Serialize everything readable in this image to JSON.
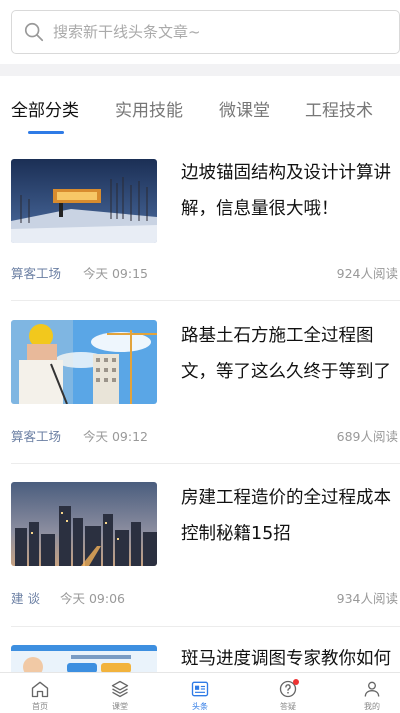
{
  "search": {
    "placeholder": "搜索新干线头条文章~"
  },
  "tabs": [
    {
      "label": "全部分类",
      "active": true
    },
    {
      "label": "实用技能",
      "active": false
    },
    {
      "label": "微课堂",
      "active": false
    },
    {
      "label": "工程技术",
      "active": false
    }
  ],
  "articles": [
    {
      "title_line1": "边坡锚固结构及设计计算讲",
      "title_line2": "解，信息量很大哦！",
      "source": "算客工场",
      "time": "今天 09:15",
      "reads": "924人阅读"
    },
    {
      "title_line1": "路基土石方施工全过程图",
      "title_line2": "文，等了这么久终于等到了",
      "source": "算客工场",
      "time": "今天 09:12",
      "reads": "689人阅读"
    },
    {
      "title_line1": "房建工程造价的全过程成本",
      "title_line2": "控制秘籍15招",
      "source": "建 谈",
      "time": "今天 09:06",
      "reads": "934人阅读"
    },
    {
      "title_line1": "斑马进度调图专家教你如何",
      "title_line2": "",
      "source": "",
      "time": "",
      "reads": ""
    }
  ],
  "bottom_nav": [
    {
      "label": "首页",
      "icon": "home-icon",
      "active": false
    },
    {
      "label": "课堂",
      "icon": "layers-icon",
      "active": false
    },
    {
      "label": "头条",
      "icon": "news-icon",
      "active": true
    },
    {
      "label": "答疑",
      "icon": "question-icon",
      "active": false,
      "badge": true
    },
    {
      "label": "我的",
      "icon": "user-icon",
      "active": false
    }
  ],
  "colors": {
    "accent": "#2f7be6",
    "badge": "#e33333",
    "source_text": "#6b7fa3"
  }
}
